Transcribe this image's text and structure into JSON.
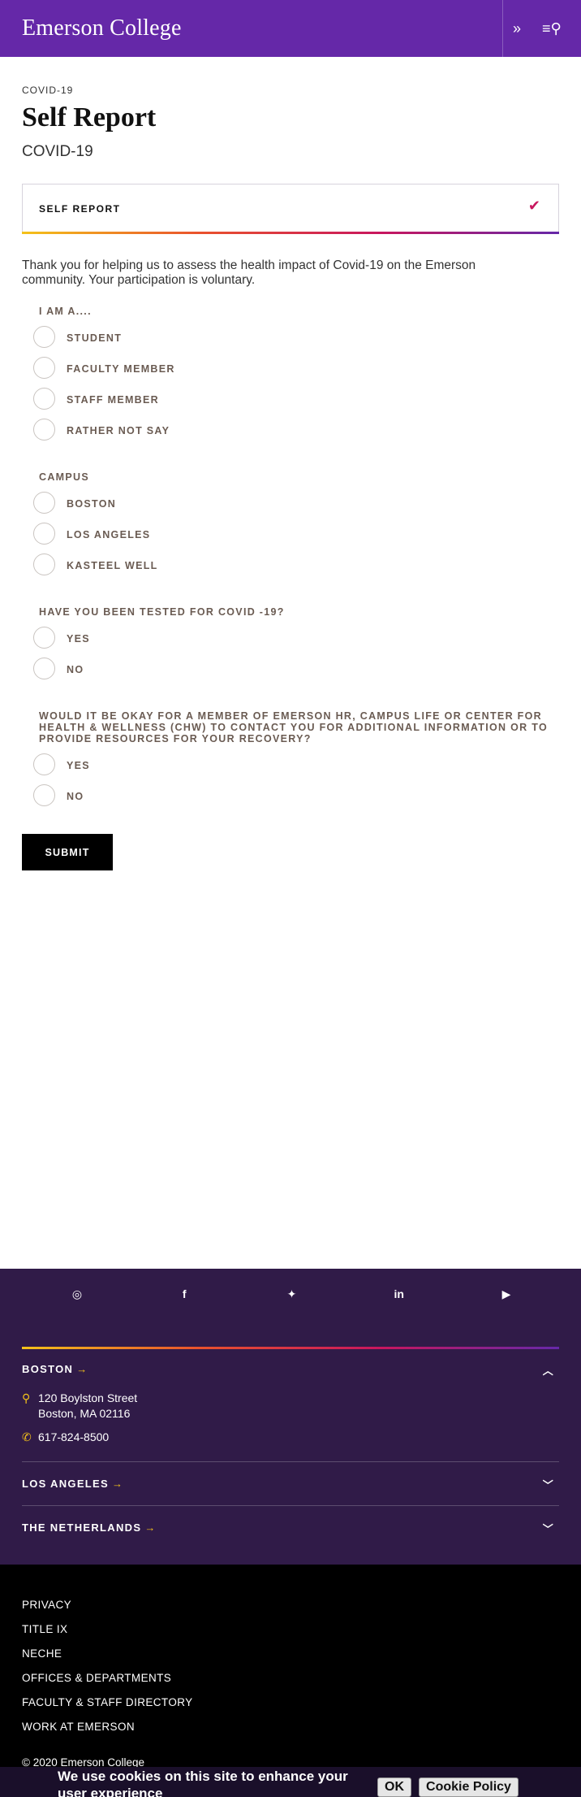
{
  "header": {
    "brand": "Emerson College",
    "forward_icon": "»",
    "menu_icon": "≡⚲"
  },
  "breadcrumb": "COVID-19",
  "page_title": "Self Report",
  "page_subtitle": "COVID-19",
  "accordion": {
    "label": "SELF REPORT",
    "chevron": "✔"
  },
  "intro": "Thank you for helping us to assess the health impact of Covid-19 on the Emerson community. Your participation is voluntary.",
  "questions": [
    {
      "label": "I AM A....",
      "options": [
        "STUDENT",
        "FACULTY MEMBER",
        "STAFF MEMBER",
        "RATHER NOT SAY"
      ]
    },
    {
      "label": "CAMPUS",
      "options": [
        "BOSTON",
        "LOS ANGELES",
        "KASTEEL WELL"
      ]
    },
    {
      "label": "HAVE YOU BEEN TESTED FOR COVID -19?",
      "options": [
        "YES",
        "NO"
      ]
    },
    {
      "label": "WOULD IT BE OKAY FOR A MEMBER OF EMERSON HR, CAMPUS LIFE OR CENTER FOR HEALTH & WELLNESS (CHW) TO CONTACT YOU FOR ADDITIONAL INFORMATION OR TO PROVIDE RESOURCES FOR YOUR RECOVERY?",
      "options": [
        "YES",
        "NO"
      ]
    }
  ],
  "submit_label": "SUBMIT",
  "footer": {
    "social_icons": [
      "instagram-icon",
      "facebook-icon",
      "twitter-icon",
      "linkedin-icon",
      "youtube-icon"
    ],
    "social_glyphs": [
      "◎",
      "f",
      "✦",
      "in",
      "▶"
    ],
    "campuses": [
      {
        "name": "BOSTON",
        "arrow": "→",
        "toggle": "︿"
      },
      {
        "name": "LOS ANGELES",
        "arrow": "→",
        "toggle": "﹀"
      },
      {
        "name": "THE NETHERLANDS",
        "arrow": "→",
        "toggle": "﹀"
      }
    ],
    "boston_address_1": "120 Boylston Street",
    "boston_address_2": "Boston, MA 02116",
    "boston_phone": "617-824-8500",
    "pin_glyph": "⚲",
    "phone_glyph": "✆",
    "links": [
      "PRIVACY",
      "TITLE IX",
      "NECHE",
      "OFFICES & DEPARTMENTS",
      "FACULTY & STAFF DIRECTORY",
      "WORK AT EMERSON"
    ],
    "copyright": "© 2020 Emerson College"
  },
  "cookie": {
    "message": "We use cookies on this site to enhance your user experience",
    "ok_label": "OK",
    "policy_label": "Cookie Policy"
  },
  "colors": {
    "brand_purple": "#6528a8",
    "footer_purple": "#301b48",
    "accent_gold": "#f4c21a"
  }
}
